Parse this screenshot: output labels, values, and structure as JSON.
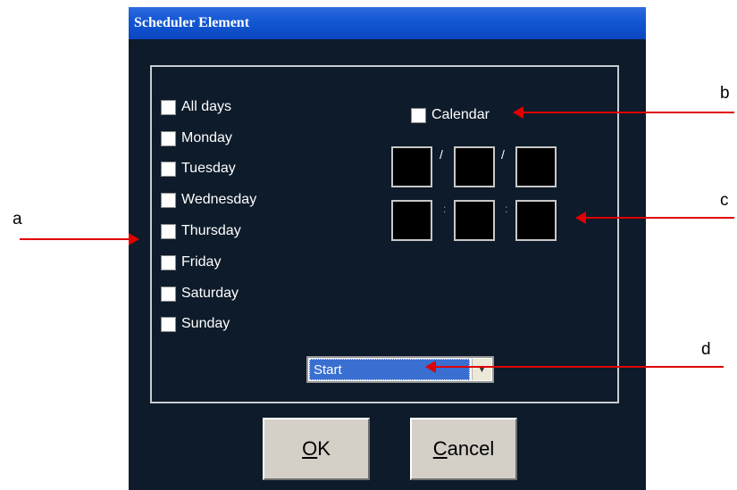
{
  "window": {
    "title": "Scheduler Element"
  },
  "days": [
    {
      "label": "All days",
      "checked": false
    },
    {
      "label": "Monday",
      "checked": false
    },
    {
      "label": "Tuesday",
      "checked": false
    },
    {
      "label": "Wednesday",
      "checked": false
    },
    {
      "label": "Thursday",
      "checked": false
    },
    {
      "label": "Friday",
      "checked": false
    },
    {
      "label": "Saturday",
      "checked": false
    },
    {
      "label": "Sunday",
      "checked": false
    }
  ],
  "calendar": {
    "label": "Calendar",
    "checked": false
  },
  "date_fields": {
    "separator": "/",
    "values": [
      "",
      "",
      ""
    ]
  },
  "time_fields": {
    "separator": ":",
    "values": [
      "",
      "",
      ""
    ]
  },
  "mode_select": {
    "value": "Start",
    "arrow_icon": "triangle-down"
  },
  "buttons": {
    "ok": "OK",
    "ok_mnemonic": "O",
    "ok_rest": "K",
    "cancel": "Cancel",
    "cancel_mnemonic": "C",
    "cancel_rest": "ancel"
  },
  "callouts": {
    "a": "a",
    "b": "b",
    "c": "c",
    "d": "d",
    "arrow_color": "#e00000"
  },
  "colors": {
    "background": "#0d1b2a",
    "title_bar": "#1458d4",
    "select_highlight": "#3a6fd2"
  }
}
